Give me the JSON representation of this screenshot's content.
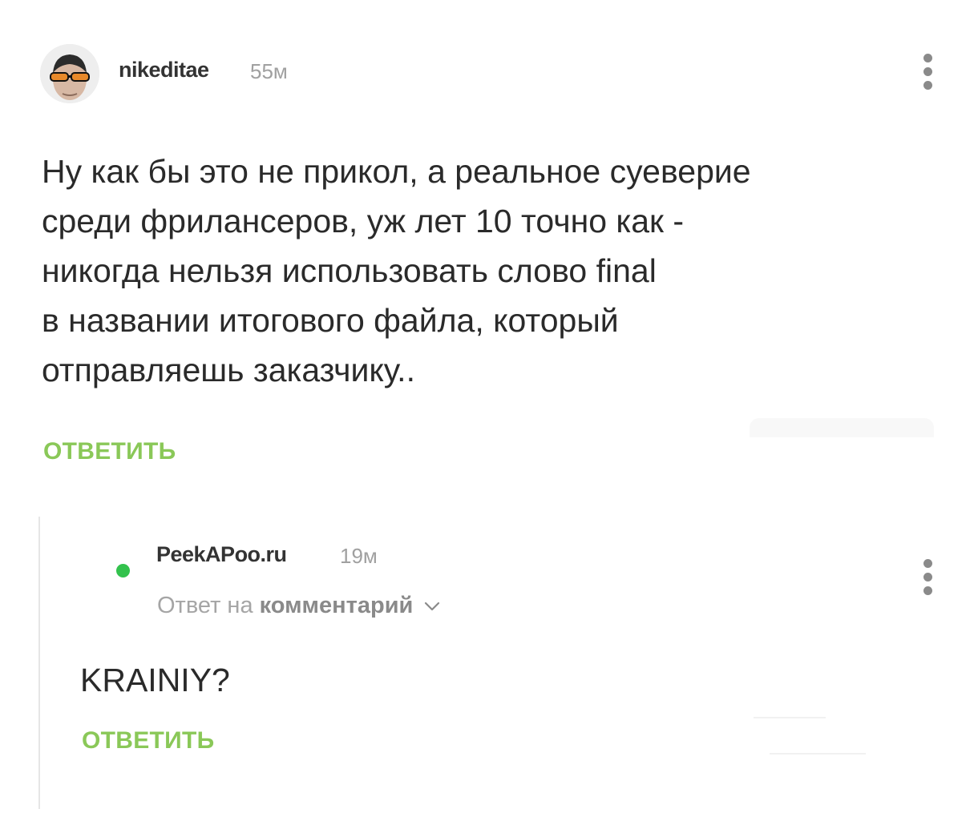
{
  "comment": {
    "username": "nikeditae",
    "time": "55м",
    "lines": [
      "Ну как бы это не прикол, а реальное суеверие",
      "среди фрилансеров, уж лет 10 точно как -",
      "никогда нельзя использовать слово final",
      "в названии итогового файла, который",
      "отправляешь заказчику.."
    ],
    "reply_label": "ОТВЕТИТЬ"
  },
  "reply": {
    "username": "PeekAPoo.ru",
    "time": "19м",
    "reply_to_prefix": "Ответ на",
    "reply_to_link": "комментарий",
    "body": "KRAINIY?",
    "reply_label": "ОТВЕТИТЬ"
  },
  "colors": {
    "accent_green": "#8ac858",
    "online_green": "#33c24d",
    "muted_gray": "#a0a0a0"
  },
  "icons": [
    "avatar",
    "more-vertical-icon",
    "online-indicator-icon",
    "chevron-down-icon"
  ]
}
